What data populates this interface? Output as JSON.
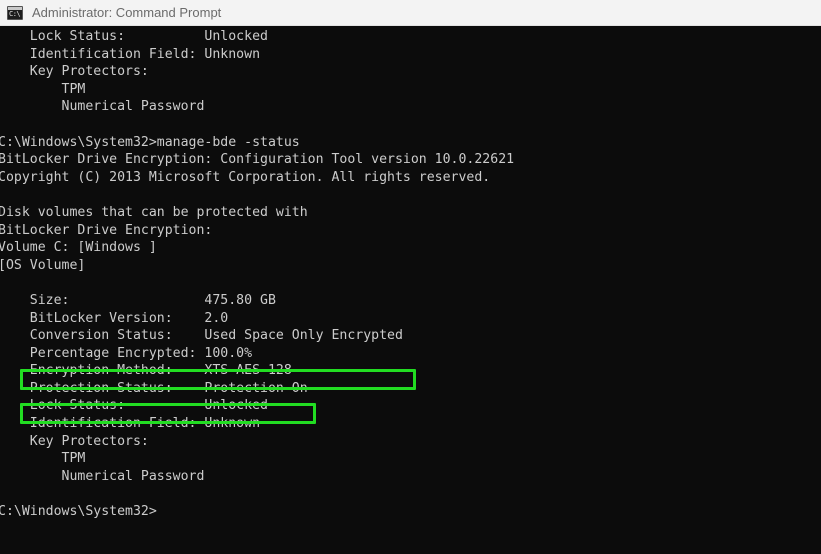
{
  "window": {
    "title": "Administrator: Command Prompt",
    "icon": "console-icon",
    "icon_glyph": "C:\\",
    "titlebar_color": "#f3f3f3",
    "background_color": "#0c0c0c",
    "text_color": "#cccccc",
    "highlight_color": "#22dd22"
  },
  "console": {
    "lines": [
      "    Lock Status:          Unlocked",
      "    Identification Field: Unknown",
      "    Key Protectors:",
      "        TPM",
      "        Numerical Password",
      "",
      "C:\\Windows\\System32>manage-bde -status",
      "BitLocker Drive Encryption: Configuration Tool version 10.0.22621",
      "Copyright (C) 2013 Microsoft Corporation. All rights reserved.",
      "",
      "Disk volumes that can be protected with",
      "BitLocker Drive Encryption:",
      "Volume C: [Windows ]",
      "[OS Volume]",
      "",
      "    Size:                 475.80 GB",
      "    BitLocker Version:    2.0",
      "    Conversion Status:    Used Space Only Encrypted",
      "    Percentage Encrypted: 100.0%",
      "    Encryption Method:    XTS-AES 128",
      "    Protection Status:    Protection On",
      "    Lock Status:          Unlocked",
      "    Identification Field: Unknown",
      "    Key Protectors:",
      "        TPM",
      "        Numerical Password",
      "",
      "C:\\Windows\\System32>"
    ],
    "command": "manage-bde -status",
    "prompt": "C:\\Windows\\System32>",
    "tool_banner": "BitLocker Drive Encryption: Configuration Tool version 10.0.22621",
    "copyright": "Copyright (C) 2013 Microsoft Corporation. All rights reserved.",
    "volume_header": "Disk volumes that can be protected with BitLocker Drive Encryption:",
    "volume_label": "Volume C: [Windows ]",
    "volume_type": "[OS Volume]",
    "fields": [
      {
        "label": "Size:",
        "value": "475.80 GB"
      },
      {
        "label": "BitLocker Version:",
        "value": "2.0"
      },
      {
        "label": "Conversion Status:",
        "value": "Used Space Only Encrypted"
      },
      {
        "label": "Percentage Encrypted:",
        "value": "100.0%"
      },
      {
        "label": "Encryption Method:",
        "value": "XTS-AES 128"
      },
      {
        "label": "Protection Status:",
        "value": "Protection On"
      },
      {
        "label": "Lock Status:",
        "value": "Unlocked"
      },
      {
        "label": "Identification Field:",
        "value": "Unknown"
      },
      {
        "label": "Key Protectors:",
        "value": ""
      }
    ],
    "key_protectors": [
      "TPM",
      "Numerical Password"
    ]
  },
  "annotations": [
    {
      "name": "conversion-status-highlight",
      "target_label": "Conversion Status:",
      "target_value": "Used Space Only Encrypted",
      "color": "#22dd22"
    },
    {
      "name": "encryption-method-highlight",
      "target_label": "Encryption Method:",
      "target_value": "XTS-AES 128",
      "color": "#22dd22"
    }
  ]
}
